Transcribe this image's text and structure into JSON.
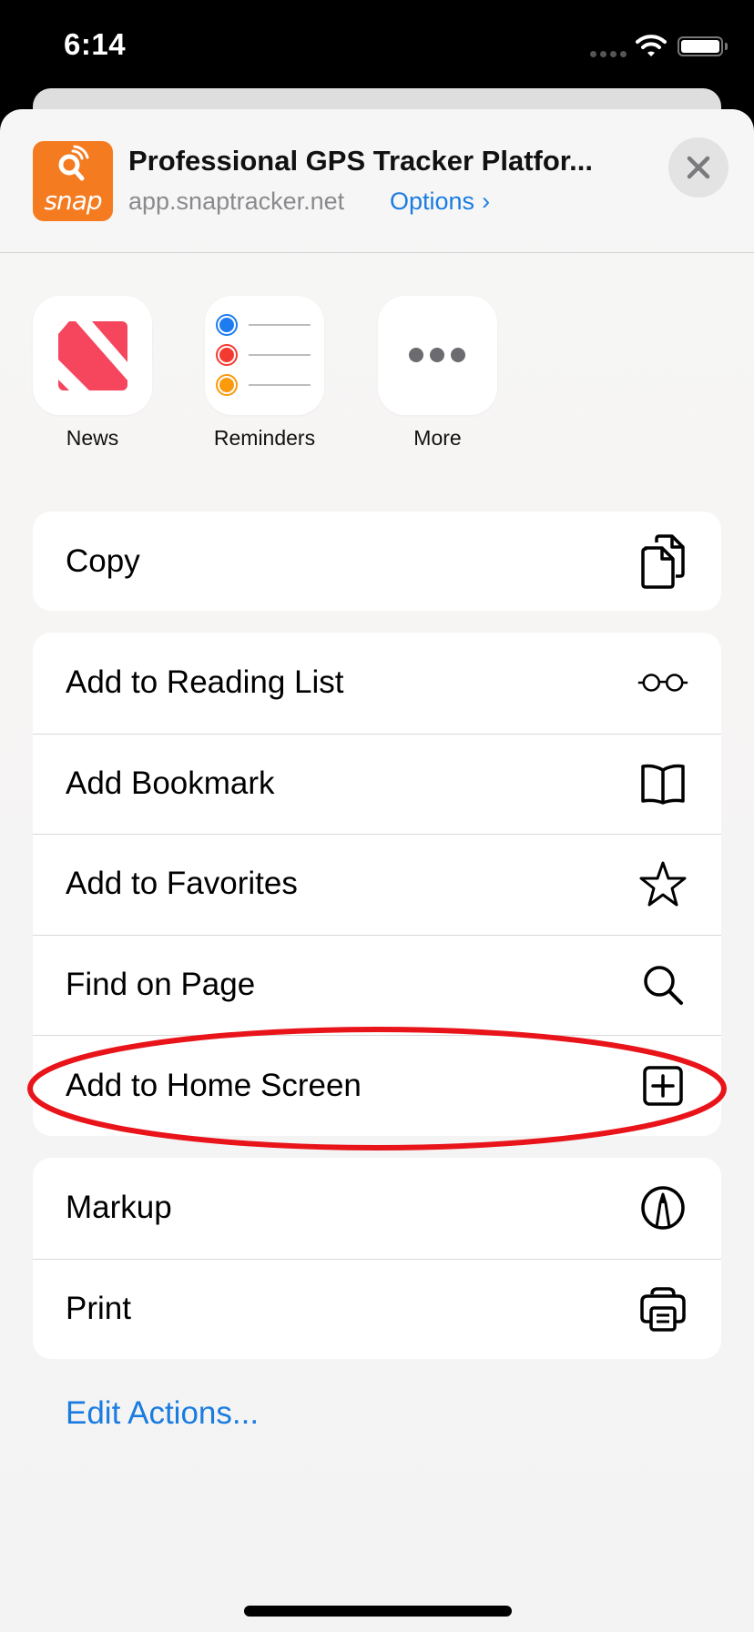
{
  "status_bar": {
    "time": "6:14",
    "signal_icon": "cellular-signal-icon",
    "wifi_icon": "wifi-icon",
    "battery_icon": "battery-icon"
  },
  "header": {
    "logo_text": "snap",
    "logo_color": "#f47b20",
    "title": "Professional GPS Tracker Platfor...",
    "url": "app.snaptracker.net",
    "options_label": "Options",
    "options_chevron": "›",
    "close_icon": "close-icon"
  },
  "apps": [
    {
      "label": "News",
      "icon": "news-app-icon"
    },
    {
      "label": "Reminders",
      "icon": "reminders-app-icon"
    },
    {
      "label": "More",
      "icon": "more-icon"
    }
  ],
  "action_groups": [
    [
      {
        "label": "Copy",
        "icon": "copy-icon"
      }
    ],
    [
      {
        "label": "Add to Reading List",
        "icon": "glasses-icon"
      },
      {
        "label": "Add Bookmark",
        "icon": "book-icon"
      },
      {
        "label": "Add to Favorites",
        "icon": "star-icon"
      },
      {
        "label": "Find on Page",
        "icon": "search-icon"
      },
      {
        "label": "Add to Home Screen",
        "icon": "plus-square-icon",
        "highlighted": true
      }
    ],
    [
      {
        "label": "Markup",
        "icon": "markup-icon"
      },
      {
        "label": "Print",
        "icon": "printer-icon"
      }
    ]
  ],
  "edit_actions_label": "Edit Actions...",
  "colors": {
    "accent": "#1a7ce0",
    "highlight_ring": "#e8141a",
    "news": "#f5465e"
  }
}
